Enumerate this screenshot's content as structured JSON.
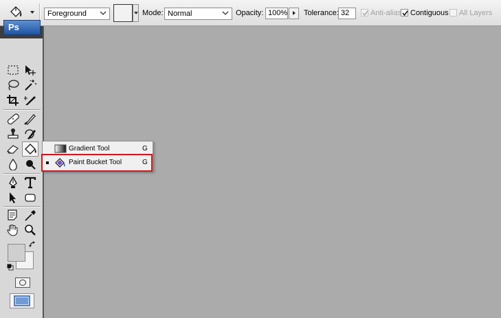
{
  "options_bar": {
    "tool_preset_icon": "paint-bucket-icon",
    "fill_source": "Foreground",
    "mode_label": "Mode:",
    "mode_value": "Normal",
    "opacity_label": "Opacity:",
    "opacity_value": "100%",
    "tolerance_label": "Tolerance:",
    "tolerance_value": "32",
    "anti_alias_label": "Anti-alias",
    "anti_alias_checked": true,
    "anti_alias_enabled": false,
    "contiguous_label": "Contiguous",
    "contiguous_checked": true,
    "all_layers_label": "All Layers",
    "all_layers_checked": false,
    "all_layers_enabled": false
  },
  "tools_panel": {
    "collapse_glyph": "◂◂",
    "logo": "Ps",
    "tools": [
      "rectangular-marquee-icon",
      "move-icon",
      "lasso-icon",
      "magic-wand-icon",
      "crop-icon",
      "slice-icon",
      "healing-brush-icon",
      "brush-icon",
      "clone-stamp-icon",
      "history-brush-icon",
      "eraser-icon",
      "paint-bucket-icon",
      "blur-icon",
      "burn-icon",
      "pen-icon",
      "type-icon",
      "path-selection-icon",
      "rectangle-shape-icon",
      "notes-icon",
      "eyedropper-icon",
      "hand-icon",
      "zoom-icon"
    ],
    "active_tool": "paint-bucket-icon",
    "foreground_color": "#cfcfcf",
    "background_color": "#f3f3f3"
  },
  "flyout": {
    "items": [
      {
        "label": "Gradient Tool",
        "shortcut": "G",
        "icon": "gradient-icon",
        "current": false
      },
      {
        "label": "Paint Bucket Tool",
        "shortcut": "G",
        "icon": "paint-bucket-icon",
        "current": true
      }
    ],
    "highlight_color": "#d1171e"
  },
  "canvas_background": "#ababab"
}
